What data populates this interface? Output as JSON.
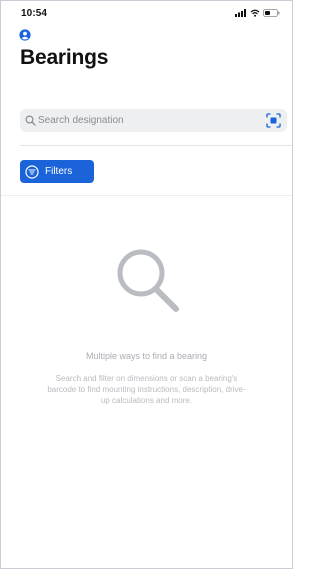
{
  "status_bar": {
    "time": "10:54"
  },
  "page": {
    "title": "Bearings"
  },
  "search": {
    "placeholder": "Search designation",
    "value": ""
  },
  "filters": {
    "label": "Filters",
    "accent": "#1a63d9"
  },
  "empty_state": {
    "heading": "Multiple ways to find a bearing",
    "text": "Search and filter on dimensions or scan a bearing's barcode to find mounting instructions, description, drive-up calculations and more.",
    "icon": "magnifier-icon"
  },
  "colors": {
    "accent": "#1a63d9",
    "search_bg": "#eeeff1",
    "muted_text": "#a9acb1"
  }
}
